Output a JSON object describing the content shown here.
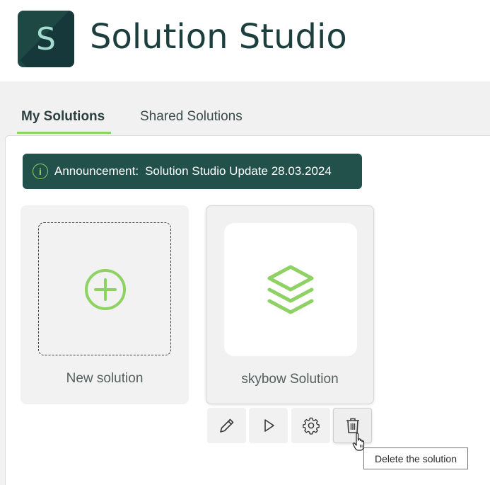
{
  "app": {
    "logo_letter": "S",
    "title": "Solution Studio"
  },
  "tabs": [
    {
      "label": "My Solutions",
      "active": true
    },
    {
      "label": "Shared Solutions",
      "active": false
    }
  ],
  "announcement": {
    "icon": "info-icon",
    "label": "Announcement:",
    "text": "Solution Studio Update 28.03.2024"
  },
  "cards": [
    {
      "label": "New solution",
      "icon": "plus-circle-icon"
    },
    {
      "label": "skybow Solution",
      "icon": "layers-icon"
    }
  ],
  "actions": [
    {
      "name": "edit",
      "icon": "pencil-icon"
    },
    {
      "name": "run",
      "icon": "play-icon"
    },
    {
      "name": "settings",
      "icon": "gear-icon"
    },
    {
      "name": "delete",
      "icon": "trash-icon"
    }
  ],
  "tooltip": {
    "text": "Delete the solution"
  },
  "colors": {
    "accent_green": "#8ed263",
    "dark_teal": "#22504b",
    "title_teal": "#1c3f3e",
    "band_gray": "#f1f1f1"
  }
}
